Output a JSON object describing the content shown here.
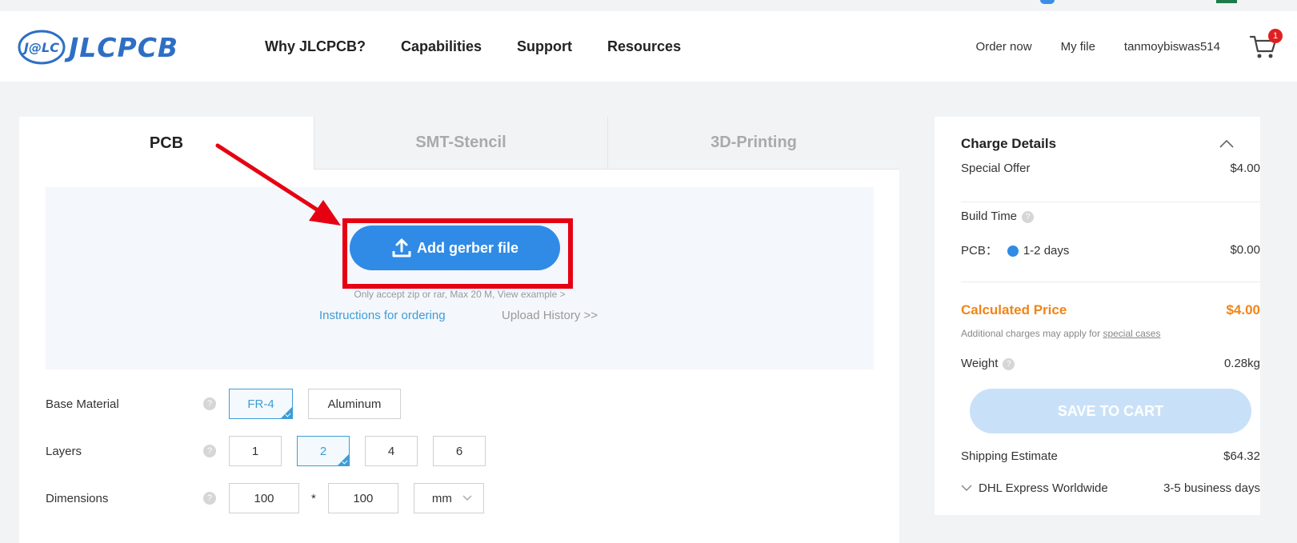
{
  "header": {
    "logo_mark": "J@LC",
    "logo_text": "JLCPCB",
    "nav": [
      "Why JLCPCB?",
      "Capabilities",
      "Support",
      "Resources"
    ],
    "order_now": "Order now",
    "my_file": "My file",
    "username": "tanmoybiswas514",
    "cart_count": "1"
  },
  "tabs": [
    "PCB",
    "SMT-Stencil",
    "3D-Printing"
  ],
  "upload": {
    "button_label": "Add gerber file",
    "note": "Only accept zip or rar, Max 20 M, View example >",
    "instructions_link": "Instructions for ordering",
    "history_link": "Upload History >>"
  },
  "options": {
    "base_material": {
      "label": "Base Material",
      "choices": [
        "FR-4",
        "Aluminum"
      ],
      "selected": "FR-4"
    },
    "layers": {
      "label": "Layers",
      "choices": [
        "1",
        "2",
        "4",
        "6"
      ],
      "selected": "2"
    },
    "dimensions": {
      "label": "Dimensions",
      "width": "100",
      "separator": "*",
      "height": "100",
      "unit": "mm"
    }
  },
  "charge": {
    "title": "Charge Details",
    "special_offer_label": "Special Offer",
    "special_offer_value": "$4.00",
    "build_time_label": "Build Time",
    "pcb_label": "PCB：",
    "pcb_time": "1-2 days",
    "pcb_value": "$0.00",
    "calculated_label": "Calculated Price",
    "calculated_value": "$4.00",
    "note_prefix": "Additional charges may apply for ",
    "note_link": "special cases",
    "weight_label": "Weight",
    "weight_value": "0.28kg",
    "save_label": "SAVE TO CART",
    "shipping_label": "Shipping Estimate",
    "shipping_value": "$64.32",
    "carrier": "DHL Express Worldwide",
    "carrier_time": "3-5 business days"
  },
  "colors": {
    "brand_blue": "#2f8be6",
    "accent_orange": "#f08519",
    "highlight_red": "#e60012"
  }
}
